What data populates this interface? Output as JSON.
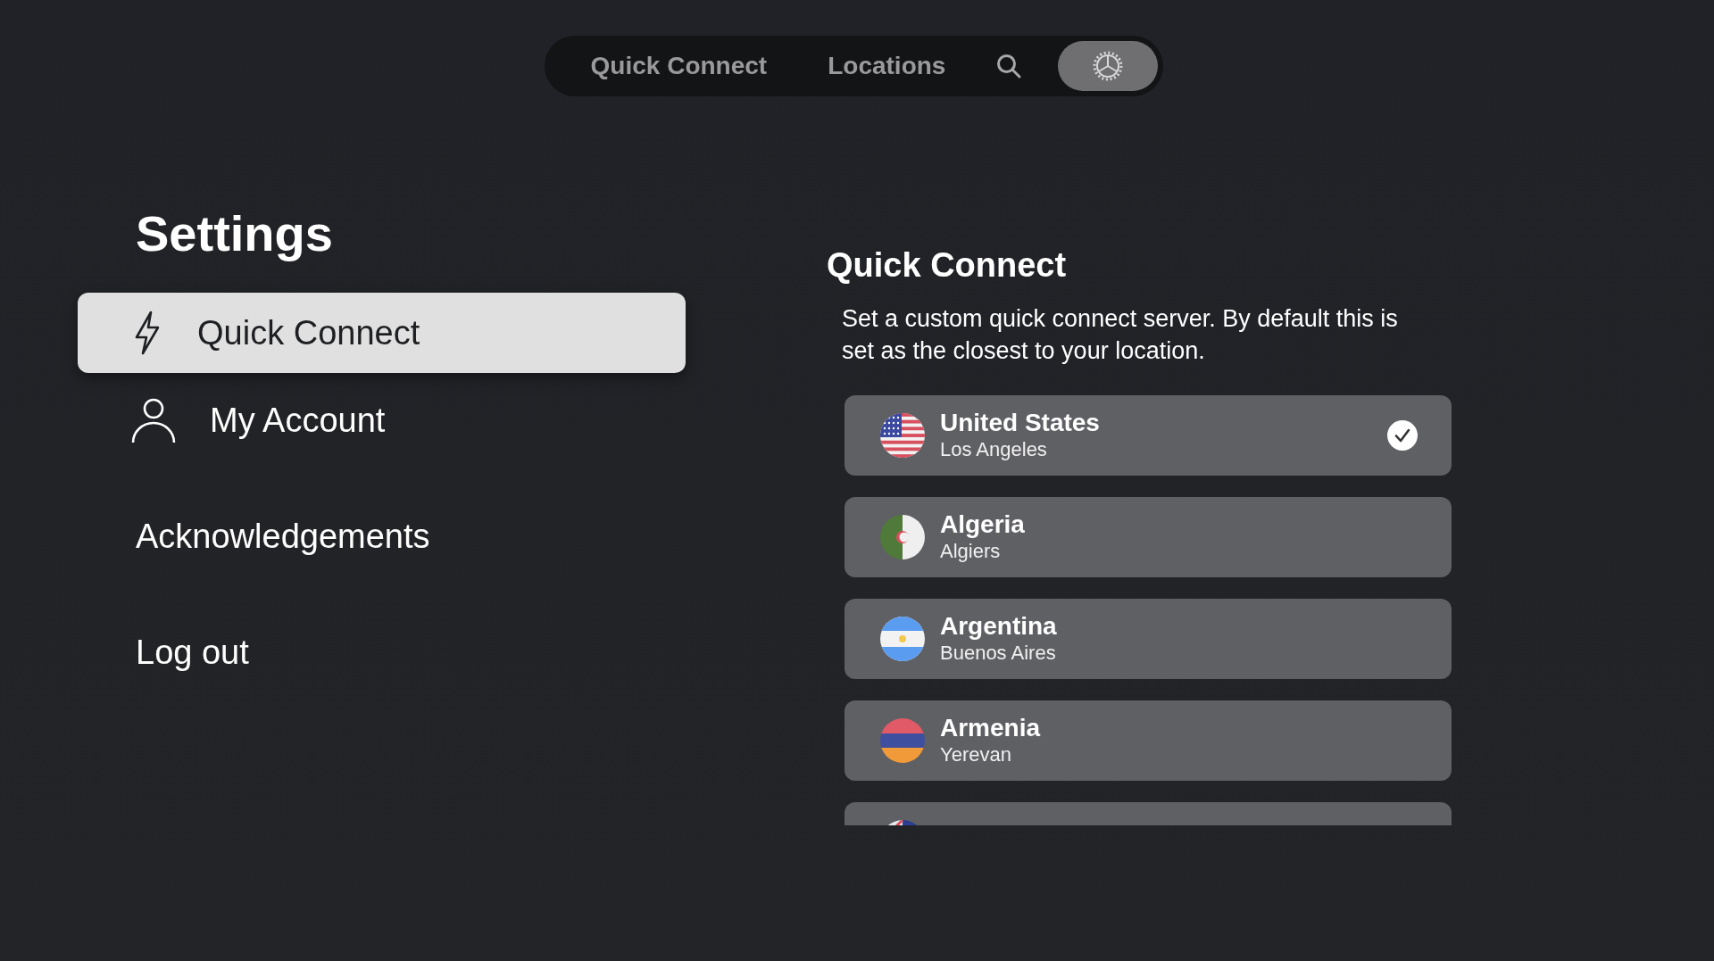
{
  "top_tabs": [
    {
      "kind": "text",
      "label": "Quick Connect",
      "selected": false
    },
    {
      "kind": "text",
      "label": "Locations",
      "selected": false
    },
    {
      "kind": "search",
      "selected": false
    },
    {
      "kind": "settings",
      "selected": true
    }
  ],
  "sidebar": {
    "title": "Settings",
    "items": [
      {
        "kind": "bolt",
        "label": "Quick Connect",
        "selected": true
      },
      {
        "kind": "person",
        "label": "My Account",
        "selected": false
      },
      {
        "kind": "plain",
        "label": "Acknowledgements",
        "selected": false
      },
      {
        "kind": "plain",
        "label": "Log out",
        "selected": false
      }
    ]
  },
  "detail": {
    "title": "Quick Connect",
    "description": "Set a custom quick connect server. By default this is set as the closest to your location.",
    "servers": [
      {
        "kind": "us",
        "country": "United States",
        "city": "Los Angeles",
        "selected": true
      },
      {
        "kind": "dz",
        "country": "Algeria",
        "city": "Algiers",
        "selected": false
      },
      {
        "kind": "ar",
        "country": "Argentina",
        "city": "Buenos Aires",
        "selected": false
      },
      {
        "kind": "am",
        "country": "Armenia",
        "city": "Yerevan",
        "selected": false
      },
      {
        "kind": "au"
      }
    ]
  }
}
